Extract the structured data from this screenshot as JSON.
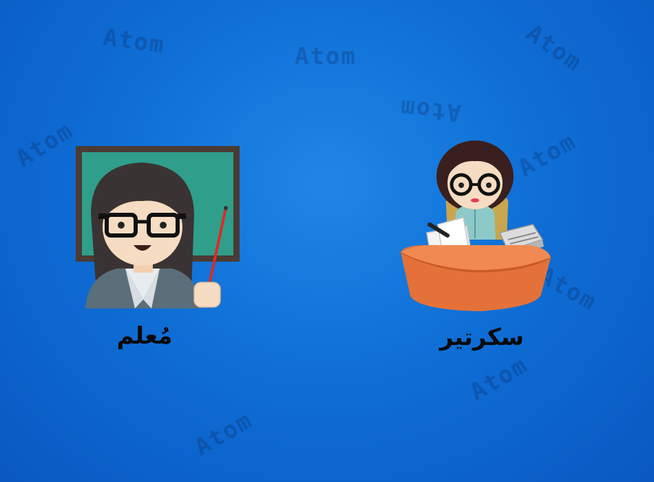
{
  "watermark": {
    "text": "Atom"
  },
  "cards": [
    {
      "id": "teacher",
      "label": "مُعلم",
      "icon": "teacher-icon"
    },
    {
      "id": "secretary",
      "label": "سكرتير",
      "icon": "secretary-icon"
    }
  ],
  "colors": {
    "background": "#0f6fd6",
    "chalkboard": "#2f9e8a",
    "chalkboard_frame": "#4a3b33",
    "desk": "#e4713a",
    "caption": "#0a0a0a"
  }
}
